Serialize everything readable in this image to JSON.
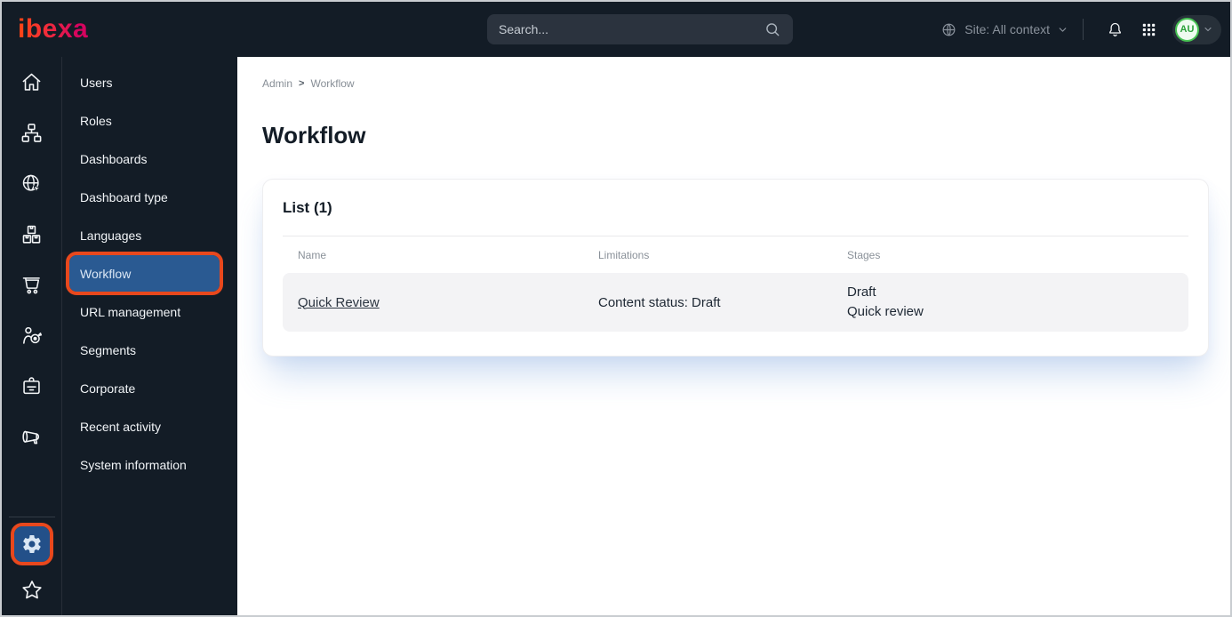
{
  "topbar": {
    "logo_text": "ibexa",
    "search_placeholder": "Search...",
    "site_context_label": "Site: All context",
    "avatar_initials": "AU"
  },
  "sidebar": {
    "items": [
      "Users",
      "Roles",
      "Dashboards",
      "Dashboard type",
      "Languages",
      "Workflow",
      "URL management",
      "Segments",
      "Corporate",
      "Recent activity",
      "System information"
    ],
    "active_item": "Workflow"
  },
  "breadcrumb": {
    "root": "Admin",
    "separator": ">",
    "current": "Workflow"
  },
  "page": {
    "title": "Workflow"
  },
  "list_card": {
    "title": "List (1)",
    "columns": [
      "Name",
      "Limitations",
      "Stages"
    ],
    "rows": [
      {
        "name": "Quick Review",
        "limitations": "Content status: Draft",
        "stages": [
          "Draft",
          "Quick review"
        ]
      }
    ]
  },
  "colors": {
    "topbar_bg": "#131c26",
    "active_blue": "#2a5a92",
    "annotation_highlight": "#e8481d",
    "logo_gradient_start": "#ff4713",
    "logo_gradient_end": "#d6045f",
    "avatar_green": "#46c152"
  }
}
